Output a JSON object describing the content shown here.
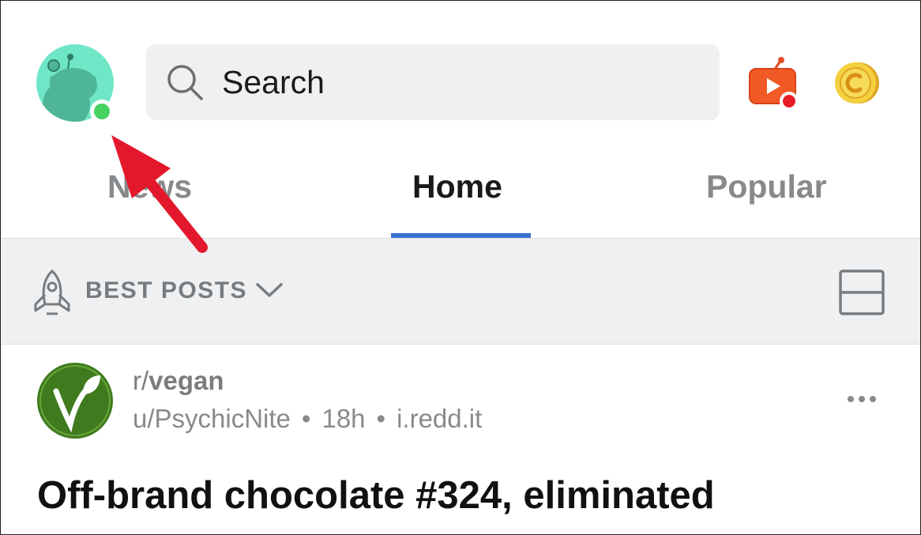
{
  "header": {
    "search_placeholder": "Search",
    "icons": {
      "avatar": "snoo-avatar",
      "search": "search-icon",
      "video": "video-record-icon",
      "coins": "coin-icon"
    }
  },
  "tabs": [
    {
      "label": "News",
      "active": false
    },
    {
      "label": "Home",
      "active": true
    },
    {
      "label": "Popular",
      "active": false
    }
  ],
  "sort_bar": {
    "label": "BEST POSTS",
    "icons": {
      "sort": "rocket-icon",
      "dropdown": "chevron-down-icon",
      "view": "card-layout-icon"
    }
  },
  "post": {
    "subreddit_prefix": "r/",
    "subreddit": "vegan",
    "author": "u/PsychicNite",
    "age": "18h",
    "domain": "i.redd.it",
    "title": "Off-brand chocolate #324, eliminated"
  },
  "colors": {
    "accent": "#3a72d0",
    "online": "#46d160",
    "annotation_arrow": "#e4182c",
    "avatar_bg": "#6fe6c6",
    "subreddit_icon_bg": "#3f7b1e"
  }
}
